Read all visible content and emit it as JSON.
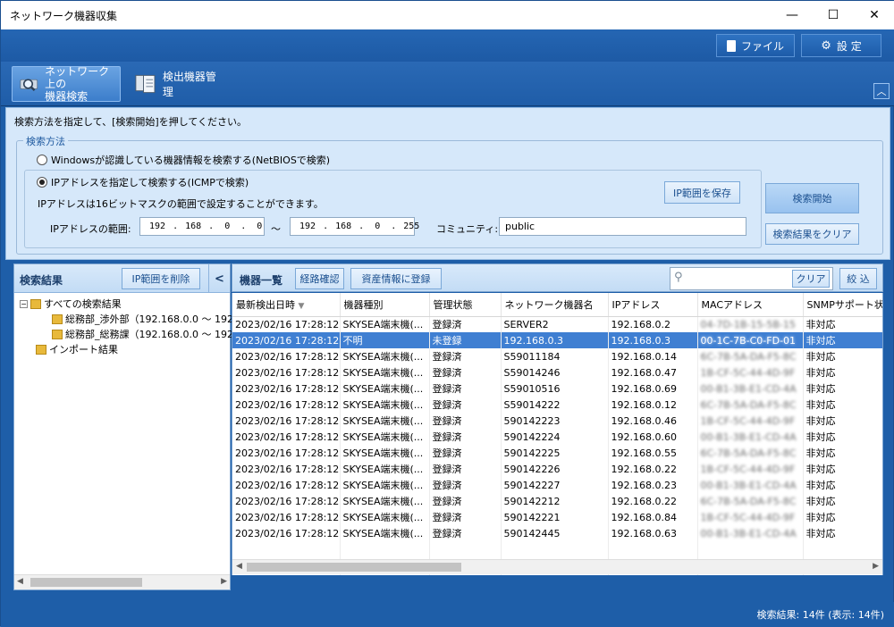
{
  "window": {
    "title": "ネットワーク機器収集"
  },
  "topbar": {
    "file_label": "ファイル",
    "settings_label": "設 定"
  },
  "nav": {
    "tabs": [
      {
        "line1": "ネットワーク上の",
        "line2": "機器検索",
        "active": true
      },
      {
        "line1": "検出機器管理",
        "line2": "",
        "active": false
      }
    ]
  },
  "search": {
    "instruction": "検索方法を指定して、[検索開始]を押してください。",
    "method_legend": "検索方法",
    "option_netbios": "Windowsが認識している機器情報を検索する(NetBIOSで検索)",
    "option_icmp": "IPアドレスを指定して検索する(ICMPで検索)",
    "icmp_note": "IPアドレスは16ビットマスクの範囲で設定することができます。",
    "range_label": "IPアドレスの範囲:",
    "ip_from": [
      "192",
      "168",
      "0",
      "0"
    ],
    "ip_to": [
      "192",
      "168",
      "0",
      "255"
    ],
    "range_sep": "〜",
    "community_label": "コミュニティ:",
    "community_value": "public",
    "save_range_button": "IP範囲を保存",
    "start_button": "検索開始",
    "clear_results_button": "検索結果をクリア"
  },
  "left": {
    "title": "検索結果",
    "delete_range_button": "IP範囲を削除",
    "collapse_glyph": "<",
    "tree": [
      {
        "label": "すべての検索結果",
        "level": 0,
        "expander": "−"
      },
      {
        "label": "総務部_渉外部（192.168.0.0 〜 192",
        "level": 1
      },
      {
        "label": "総務部_総務課（192.168.0.0 〜 192",
        "level": 1
      },
      {
        "label": "インポート結果",
        "level": 0
      }
    ]
  },
  "devices": {
    "title": "機器一覧",
    "route_button": "経路確認",
    "register_button": "資産情報に登録",
    "search_placeholder": "",
    "clear_button": "クリア",
    "filter_button": "絞 込",
    "columns": [
      "最新検出日時",
      "機器種別",
      "管理状態",
      "ネットワーク機器名",
      "IPアドレス",
      "MACアドレス",
      "SNMPサポート状"
    ],
    "sort_indicator": "▼",
    "rows": [
      [
        "2023/02/16 17:28:12",
        "SKYSEA端末機(...",
        "登録済",
        "SERVER2",
        "192.168.0.2",
        "04-7D-1B-15-5B-15",
        "非対応"
      ],
      [
        "2023/02/16 17:28:12",
        "不明",
        "未登録",
        "192.168.0.3",
        "192.168.0.3",
        "00-1C-7B-C0-FD-01",
        "非対応"
      ],
      [
        "2023/02/16 17:28:12",
        "SKYSEA端末機(...",
        "登録済",
        "S59011184",
        "192.168.0.14",
        "6C-7B-5A-DA-F5-8C",
        "非対応"
      ],
      [
        "2023/02/16 17:28:12",
        "SKYSEA端末機(...",
        "登録済",
        "S59014246",
        "192.168.0.47",
        "1B-CF-5C-44-4D-9F",
        "非対応"
      ],
      [
        "2023/02/16 17:28:12",
        "SKYSEA端末機(...",
        "登録済",
        "S59010516",
        "192.168.0.69",
        "00-B1-3B-E1-CD-4A",
        "非対応"
      ],
      [
        "2023/02/16 17:28:12",
        "SKYSEA端末機(...",
        "登録済",
        "S59014222",
        "192.168.0.12",
        "6C-7B-5A-DA-F5-8C",
        "非対応"
      ],
      [
        "2023/02/16 17:28:12",
        "SKYSEA端末機(...",
        "登録済",
        "590142223",
        "192.168.0.46",
        "1B-CF-5C-44-4D-9F",
        "非対応"
      ],
      [
        "2023/02/16 17:28:12",
        "SKYSEA端末機(...",
        "登録済",
        "590142224",
        "192.168.0.60",
        "00-B1-3B-E1-CD-4A",
        "非対応"
      ],
      [
        "2023/02/16 17:28:12",
        "SKYSEA端末機(...",
        "登録済",
        "590142225",
        "192.168.0.55",
        "6C-7B-5A-DA-F5-8C",
        "非対応"
      ],
      [
        "2023/02/16 17:28:12",
        "SKYSEA端末機(...",
        "登録済",
        "590142226",
        "192.168.0.22",
        "1B-CF-5C-44-4D-9F",
        "非対応"
      ],
      [
        "2023/02/16 17:28:12",
        "SKYSEA端末機(...",
        "登録済",
        "590142227",
        "192.168.0.23",
        "00-B1-3B-E1-CD-4A",
        "非対応"
      ],
      [
        "2023/02/16 17:28:12",
        "SKYSEA端末機(...",
        "登録済",
        "590142212",
        "192.168.0.22",
        "6C-7B-5A-DA-F5-8C",
        "非対応"
      ],
      [
        "2023/02/16 17:28:12",
        "SKYSEA端末機(...",
        "登録済",
        "590142221",
        "192.168.0.84",
        "1B-CF-5C-44-4D-9F",
        "非対応"
      ],
      [
        "2023/02/16 17:28:12",
        "SKYSEA端末機(...",
        "登録済",
        "590142445",
        "192.168.0.63",
        "00-B1-3B-E1-CD-4A",
        "非対応"
      ]
    ]
  },
  "status": {
    "text": "検索結果: 14件 (表示: 14件)"
  },
  "colors": {
    "accent": "#1e5ea8",
    "panel": "#d6e8fa",
    "selection": "#3f7fd2"
  }
}
